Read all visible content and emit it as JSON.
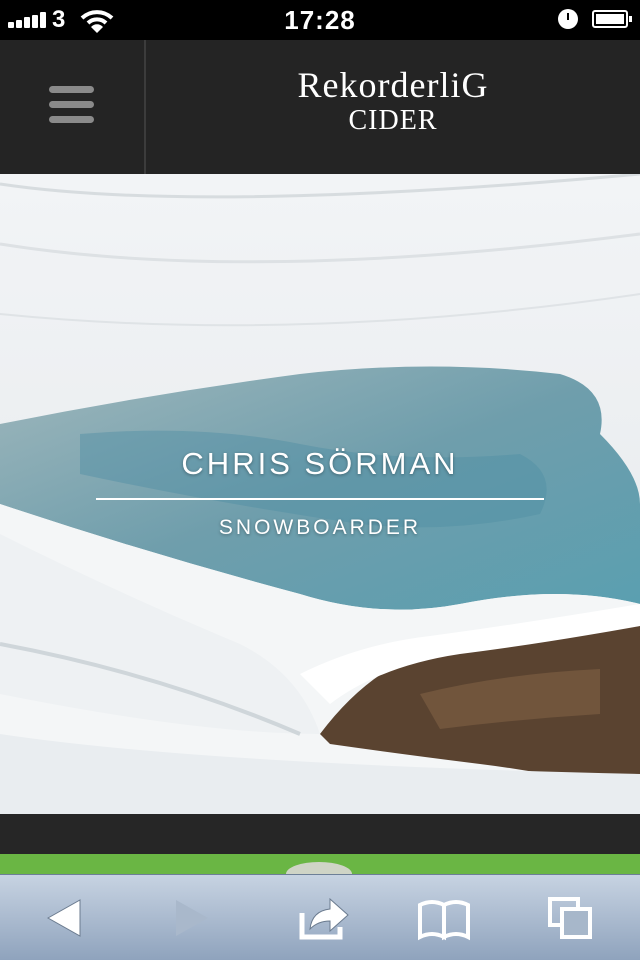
{
  "status_bar": {
    "carrier": "3",
    "time": "17:28",
    "icons": [
      "signal-icon",
      "wifi-icon",
      "alarm-icon",
      "battery-icon"
    ]
  },
  "header": {
    "menu_icon": "hamburger-menu-icon",
    "logo_line1": "RekorderliG",
    "logo_line2": "CIDER"
  },
  "hero": {
    "name": "CHRIS SÖRMAN",
    "role": "SNOWBOARDER"
  },
  "toolbar": {
    "icons": [
      "back-icon",
      "forward-icon",
      "share-icon",
      "bookmarks-icon",
      "tabs-icon"
    ]
  },
  "colors": {
    "status_bar_bg": "#000000",
    "header_bg": "#242424",
    "accent_green": "#6ab644",
    "toolbar_gradient_top": "#c7d3e2",
    "toolbar_gradient_bottom": "#8fa3bd"
  }
}
